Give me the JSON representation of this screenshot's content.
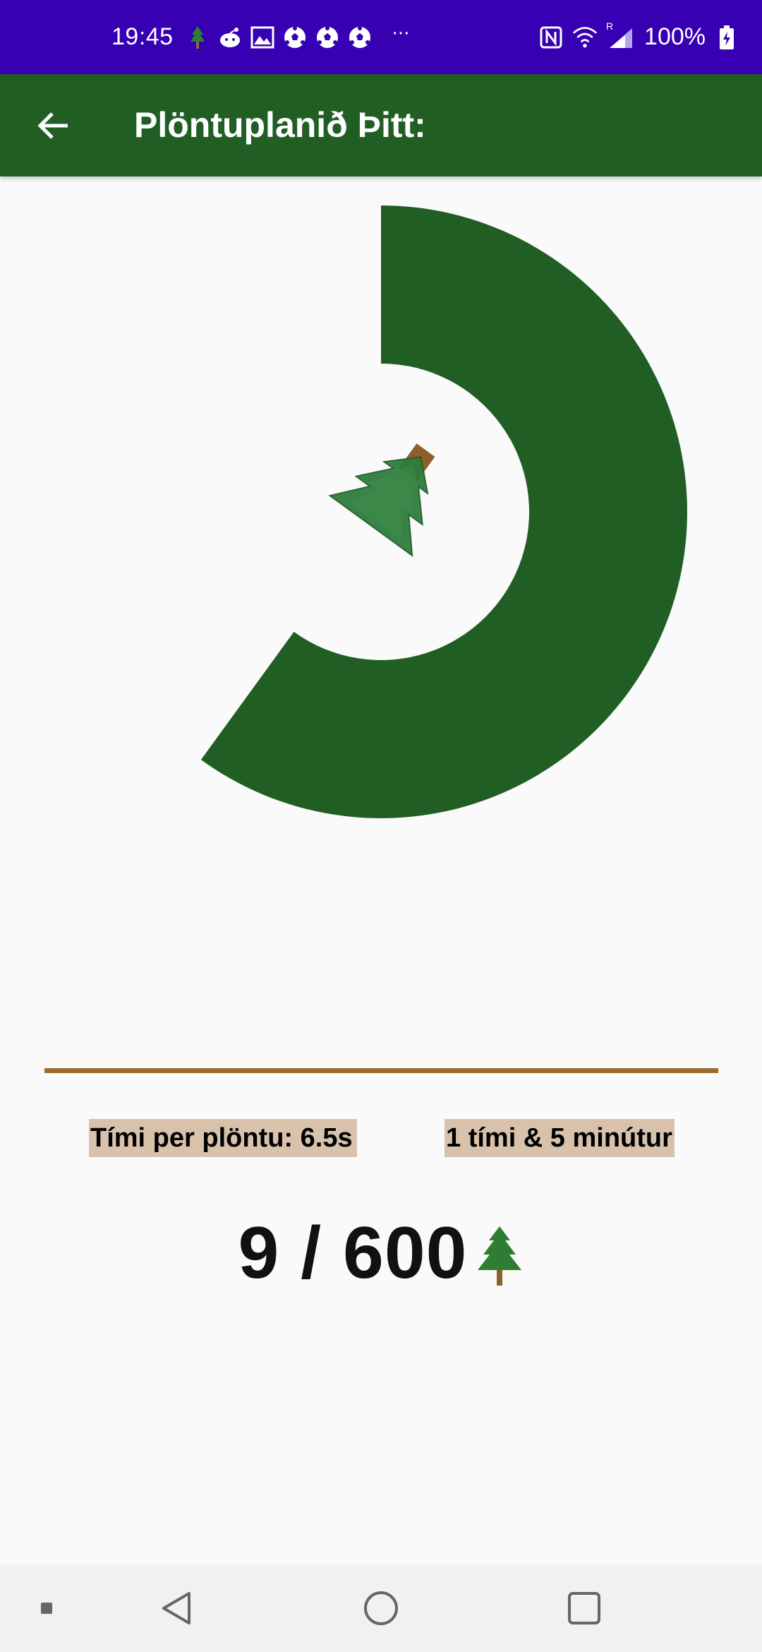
{
  "status_bar": {
    "time": "19:45",
    "battery": "100%",
    "more": "···",
    "roaming": "R"
  },
  "app_bar": {
    "title": "Plöntuplanið Þitt:"
  },
  "progress": {
    "planted": 9,
    "total": 600,
    "fraction_shown": 0.6
  },
  "info": {
    "time_per_plant": "Tími per plöntu: 6.5s",
    "total_time": "1 tími & 5 minútur"
  },
  "counter": {
    "text": "9 / 600"
  },
  "colors": {
    "status_bar": "#3700b3",
    "app_bar": "#215e24",
    "donut": "#215e24",
    "divider": "#9e6b2e",
    "label_bg": "#d9c2ab"
  },
  "icons": {
    "back": "arrow-left-icon",
    "tree": "tree-icon",
    "nav_back": "triangle-back-icon",
    "nav_home": "circle-home-icon",
    "nav_recents": "square-recents-icon"
  }
}
